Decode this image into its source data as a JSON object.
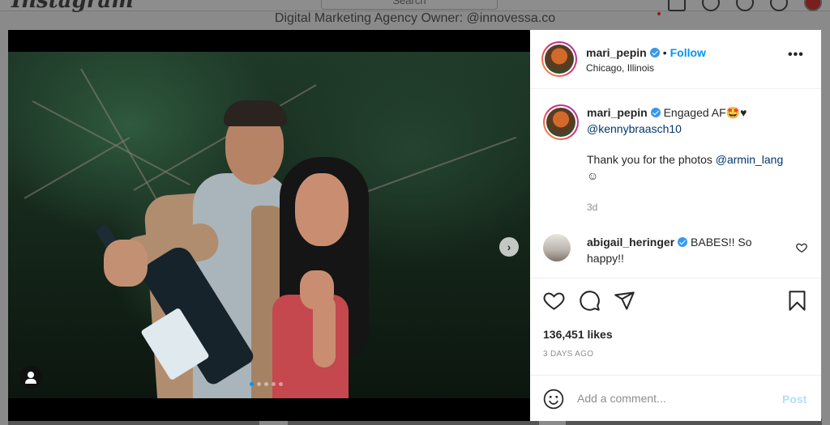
{
  "background": {
    "logo": "Instagram",
    "search_placeholder": "Search",
    "bio_line": "Digital Marketing Agency Owner: @innovessa.co"
  },
  "post": {
    "author": {
      "username": "mari_pepin",
      "verified": true,
      "follow_label": "Follow",
      "location": "Chicago, Illinois"
    },
    "caption": {
      "username": "mari_pepin",
      "text_1": "Engaged AF",
      "emoji_1": "🤩",
      "emoji_2": "♥",
      "mention_1": "@kennybraasch10",
      "text_2": "Thank you for the photos",
      "mention_2": "@armin_lang",
      "emoji_3": "☺",
      "time": "3d"
    },
    "comments": [
      {
        "username": "abigail_heringer",
        "verified": true,
        "text": "BABES!! So happy!!"
      }
    ],
    "likes": "136,451 likes",
    "posted_ago": "3 DAYS AGO",
    "carousel": {
      "count": 5,
      "active_index": 0
    }
  },
  "add_comment": {
    "placeholder": "Add a comment...",
    "post_label": "Post"
  },
  "colors": {
    "accent": "#0095f6",
    "verified": "#3897f0",
    "mention": "#00376b",
    "post_disabled": "#b2dffc"
  }
}
